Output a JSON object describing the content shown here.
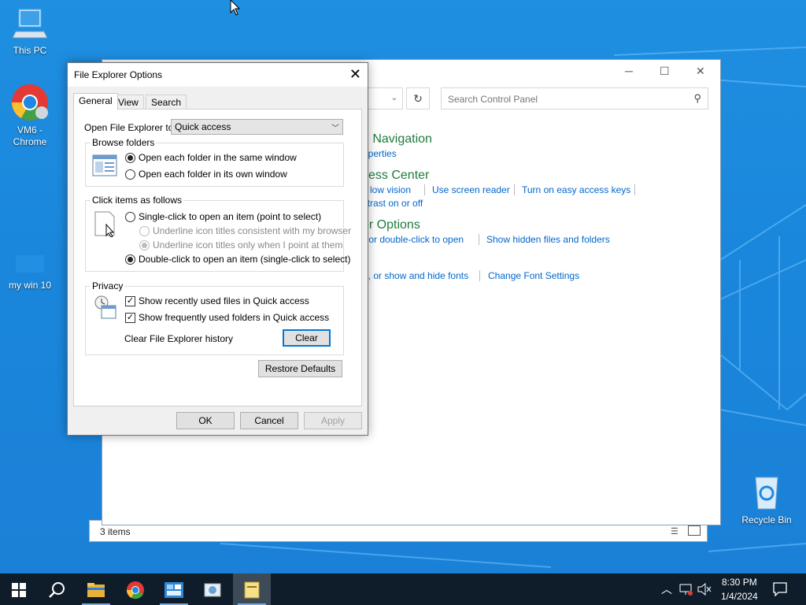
{
  "desktop": {
    "icons": [
      {
        "label": "This PC"
      },
      {
        "label": "VM6 - Chrome"
      },
      {
        "label": "my win 10"
      },
      {
        "label": "Recycle Bin"
      }
    ]
  },
  "control_panel": {
    "search_placeholder": "Search Control Panel",
    "headings": [
      "d Navigation",
      "cess Center",
      "er Options"
    ],
    "links": {
      "properties": "operties",
      "low_vision": "e low vision",
      "screen_reader": "Use screen reader",
      "easy_keys": "Turn on easy access keys",
      "contrast": "ntrast on or off",
      "click_open": "- or double-click to open",
      "hidden_files": "Show hidden files and folders",
      "fonts": "e, or show and hide fonts",
      "font_settings": "Change Font Settings"
    },
    "status": "3 items"
  },
  "dialog": {
    "title": "File Explorer Options",
    "tabs": [
      "General",
      "View",
      "Search"
    ],
    "open_label": "Open File Explorer to:",
    "open_value": "Quick access",
    "browse": {
      "legend": "Browse folders",
      "same_window": "Open each folder in the same window",
      "own_window": "Open each folder in its own window"
    },
    "click": {
      "legend": "Click items as follows",
      "single": "Single-click to open an item (point to select)",
      "underline_browser": "Underline icon titles consistent with my browser",
      "underline_point": "Underline icon titles only when I point at them",
      "double": "Double-click to open an item (single-click to select)"
    },
    "privacy": {
      "legend": "Privacy",
      "recent_files": "Show recently used files in Quick access",
      "frequent_folders": "Show frequently used folders in Quick access",
      "clear_history": "Clear File Explorer history",
      "clear_button": "Clear"
    },
    "restore_defaults": "Restore Defaults",
    "ok": "OK",
    "cancel": "Cancel",
    "apply": "Apply"
  },
  "taskbar": {
    "time": "8:30 PM",
    "date": "1/4/2024"
  }
}
